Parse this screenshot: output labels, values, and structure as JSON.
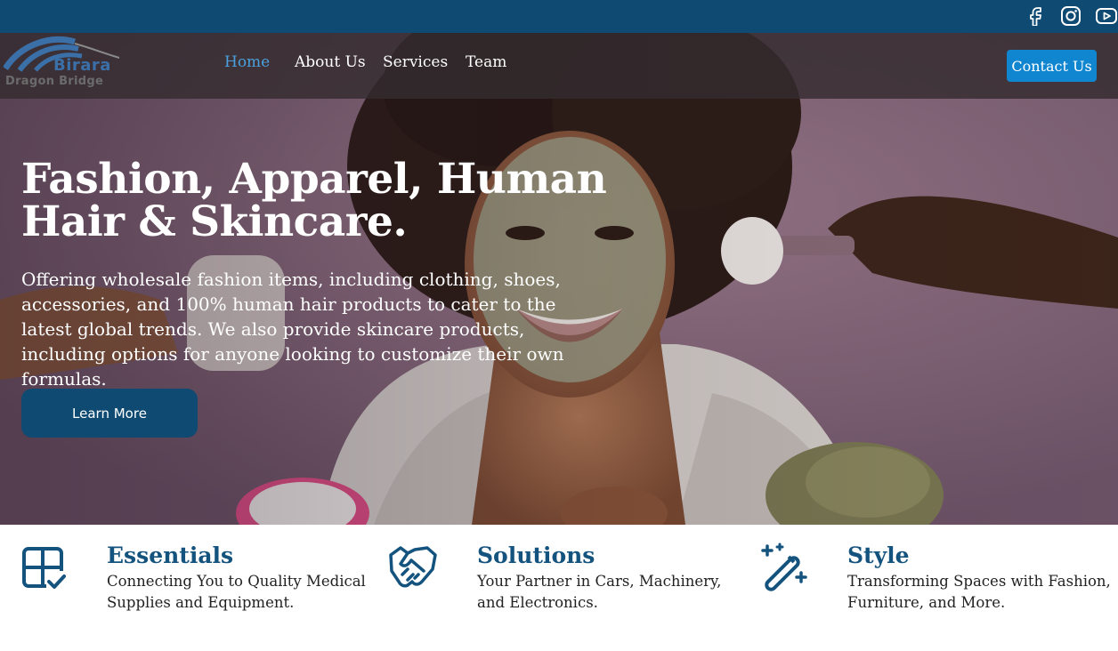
{
  "topbar": {
    "social": [
      {
        "icon": "facebook-icon"
      },
      {
        "icon": "instagram-icon"
      },
      {
        "icon": "youtube-icon"
      }
    ]
  },
  "logo": {
    "line1": "Birara",
    "line2": "Dragon Bridge"
  },
  "nav": {
    "items": [
      {
        "label": "Home",
        "active": true
      },
      {
        "label": "About Us",
        "active": false
      },
      {
        "label": "Services",
        "active": false
      },
      {
        "label": "Team",
        "active": false
      }
    ],
    "cta_label": "Contact Us"
  },
  "hero": {
    "title_line1": "Fashion, Apparel, Human",
    "title_line2": "Hair & Skincare.",
    "subtitle": "Offering wholesale fashion items, including clothing, shoes, accessories, and 100% human hair products to cater to the latest global trends. We also provide skincare products, including options for anyone looking to customize their own formulas.",
    "button_label": "Learn More"
  },
  "features": [
    {
      "icon": "grid-check-icon",
      "title": "Essentials",
      "desc": "Connecting You to Quality Medical Supplies and Equipment."
    },
    {
      "icon": "handshake-icon",
      "title": "Solutions",
      "desc": "Your Partner in Cars, Machinery, and Electronics."
    },
    {
      "icon": "magic-wand-icon",
      "title": "Style",
      "desc": "Transforming Spaces with Fashion, Furniture, and More."
    }
  ],
  "colors": {
    "topbar": "#0e4a72",
    "nav_active": "#4aa0dc",
    "contact_button": "#1186d0",
    "learn_button": "#0e4a72",
    "feature_title": "#14537e"
  }
}
